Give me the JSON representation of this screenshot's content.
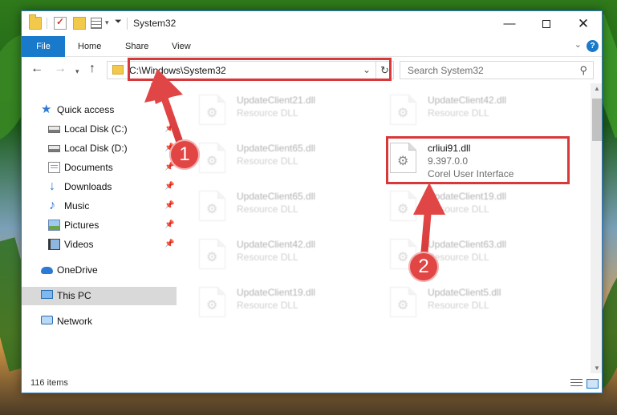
{
  "window": {
    "title": "System32"
  },
  "ribbon": {
    "tabs": {
      "file": "File",
      "home": "Home",
      "share": "Share",
      "view": "View"
    }
  },
  "address": {
    "path": "C:\\Windows\\System32"
  },
  "search": {
    "placeholder": "Search System32"
  },
  "sidebar": {
    "items": [
      {
        "label": "Quick access",
        "icon": "star-icon",
        "pinned": false,
        "selected": false
      },
      {
        "label": "Local Disk (C:)",
        "icon": "drive-icon",
        "pinned": true,
        "selected": false
      },
      {
        "label": "Local Disk (D:)",
        "icon": "drive-icon",
        "pinned": true,
        "selected": false
      },
      {
        "label": "Documents",
        "icon": "documents-icon",
        "pinned": true,
        "selected": false
      },
      {
        "label": "Downloads",
        "icon": "download-icon",
        "pinned": true,
        "selected": false
      },
      {
        "label": "Music",
        "icon": "music-icon",
        "pinned": true,
        "selected": false
      },
      {
        "label": "Pictures",
        "icon": "pictures-icon",
        "pinned": true,
        "selected": false
      },
      {
        "label": "Videos",
        "icon": "videos-icon",
        "pinned": true,
        "selected": false
      },
      {
        "label": "OneDrive",
        "icon": "cloud-icon",
        "pinned": false,
        "selected": false
      },
      {
        "label": "This PC",
        "icon": "computer-icon",
        "pinned": false,
        "selected": true
      },
      {
        "label": "Network",
        "icon": "network-icon",
        "pinned": false,
        "selected": false
      }
    ]
  },
  "files": {
    "left": [
      {
        "name": "UpdateClient21.dll",
        "type": "Resource DLL"
      },
      {
        "name": "UpdateClient65.dll",
        "type": "Resource DLL"
      },
      {
        "name": "UpdateClient65.dll",
        "type": "Resource DLL"
      },
      {
        "name": "UpdateClient42.dll",
        "type": "Resource DLL"
      },
      {
        "name": "UpdateClient19.dll",
        "type": "Resource DLL"
      }
    ],
    "right": [
      {
        "name": "UpdateClient42.dll",
        "type": "Resource DLL"
      },
      {
        "name": "UpdateClient19.dll",
        "type": "Resource DLL"
      },
      {
        "name": "UpdateClient63.dll",
        "type": "Resource DLL"
      },
      {
        "name": "UpdateClient5.dll",
        "type": "Resource DLL"
      }
    ],
    "highlighted": {
      "name": "crliui91.dll",
      "version": "9.397.0.0",
      "description": "Corel User Interface"
    }
  },
  "status": {
    "item_count": "116 items"
  },
  "markers": {
    "step1": "1",
    "step2": "2"
  },
  "colors": {
    "accent": "#1979ca",
    "highlight": "#d8383a",
    "marker": "#e14544"
  }
}
